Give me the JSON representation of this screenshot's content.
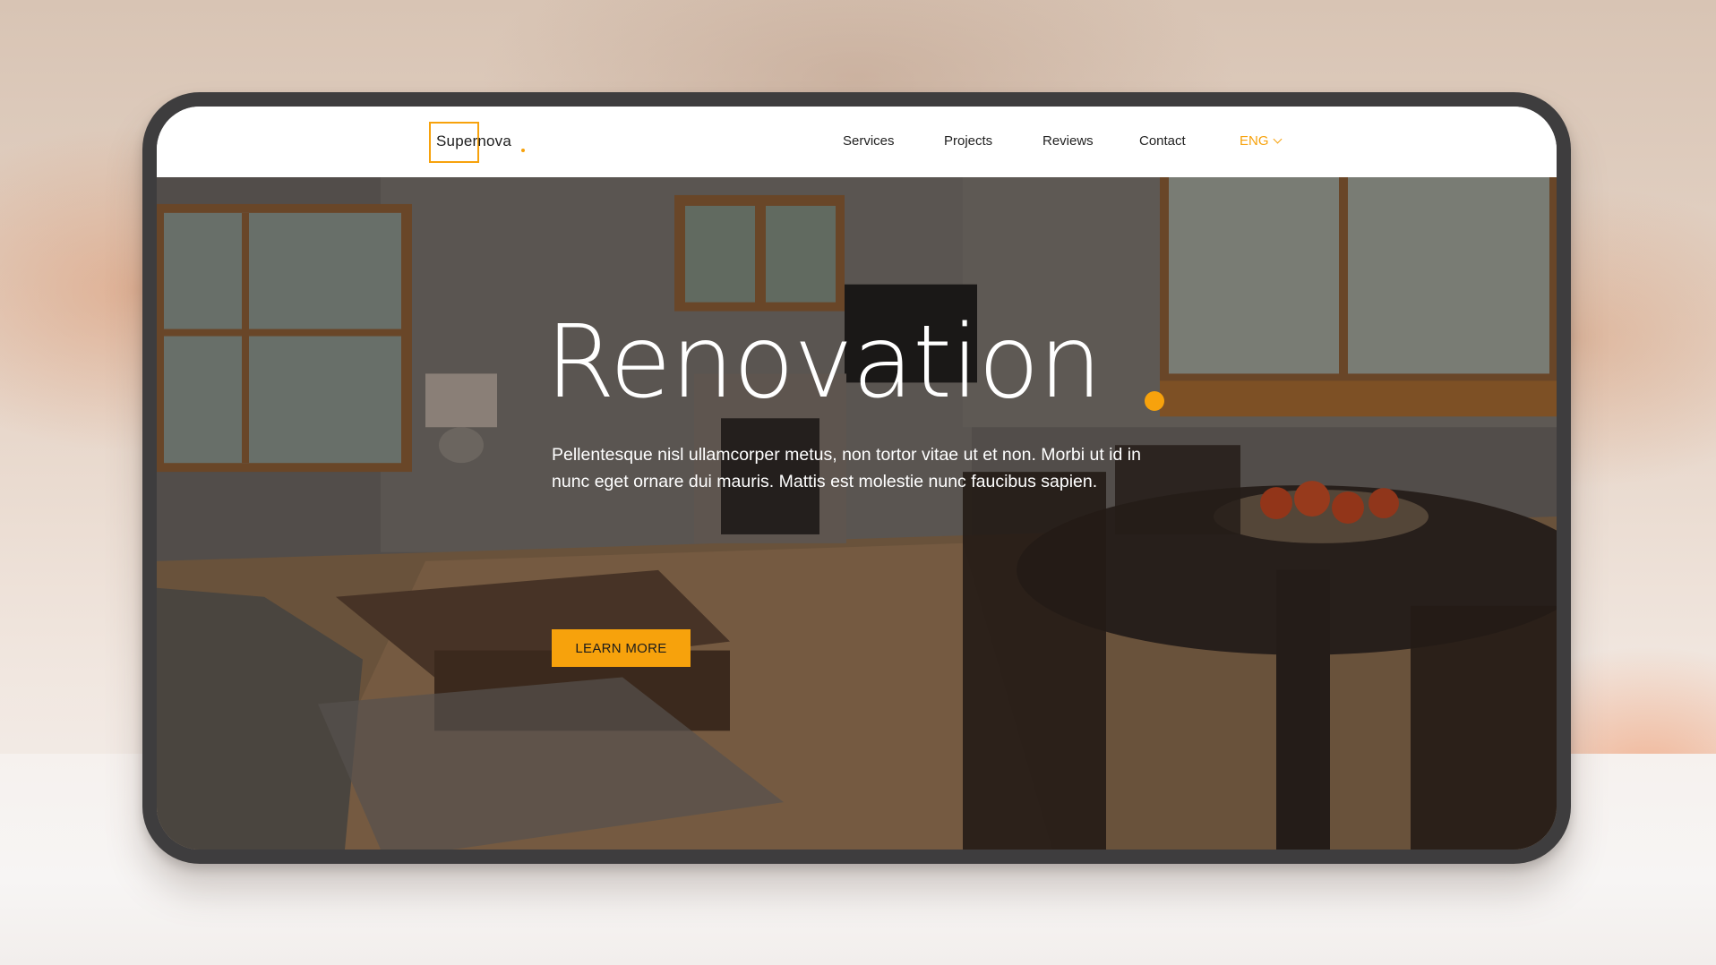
{
  "brand": {
    "name": "Supernova",
    "accent_color": "#f7a20c"
  },
  "nav": {
    "items": [
      {
        "label": "Services"
      },
      {
        "label": "Projects"
      },
      {
        "label": "Reviews"
      },
      {
        "label": "Contact"
      }
    ],
    "language": "ENG",
    "language_icon": "chevron-down-icon"
  },
  "hero": {
    "title": "Renovation",
    "body": "Pellentesque nisl ullamcorper metus, non tortor vitae ut et non. Morbi ut id in nunc eget ornare dui mauris. Mattis est molestie nunc faucibus sapien.",
    "cta_label": "LEARN MORE"
  }
}
